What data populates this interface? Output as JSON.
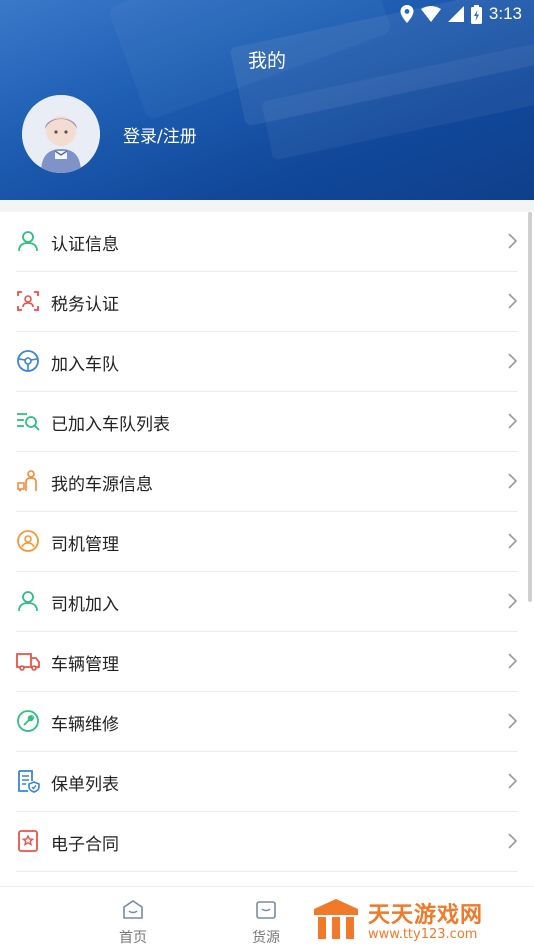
{
  "status_bar": {
    "time": "3:13"
  },
  "header": {
    "title": "我的",
    "login_label": "登录/注册"
  },
  "menu": {
    "items": [
      {
        "label": "认证信息",
        "icon": "user-verify-icon",
        "color": "#2fbf7f"
      },
      {
        "label": "税务认证",
        "icon": "face-scan-icon",
        "color": "#e8534a"
      },
      {
        "label": "加入车队",
        "icon": "steering-wheel-icon",
        "color": "#3a84d9"
      },
      {
        "label": "已加入车队列表",
        "icon": "list-search-icon",
        "color": "#2fbf7f"
      },
      {
        "label": "我的车源信息",
        "icon": "driver-truck-icon",
        "color": "#f08a3a"
      },
      {
        "label": "司机管理",
        "icon": "driver-wheel-icon",
        "color": "#f29a3a"
      },
      {
        "label": "司机加入",
        "icon": "person-add-icon",
        "color": "#2fbf7f"
      },
      {
        "label": "车辆管理",
        "icon": "truck-icon",
        "color": "#e8534a"
      },
      {
        "label": "车辆维修",
        "icon": "wrench-icon",
        "color": "#2fbf7f"
      },
      {
        "label": "保单列表",
        "icon": "policy-list-icon",
        "color": "#3a84d9"
      },
      {
        "label": "电子合同",
        "icon": "contract-icon",
        "color": "#e8534a"
      }
    ]
  },
  "tabbar": {
    "tabs": [
      {
        "label": "首页"
      },
      {
        "label": "货源"
      }
    ]
  },
  "watermark": {
    "title": "天天游戏网",
    "url": "www.tty123.com"
  }
}
